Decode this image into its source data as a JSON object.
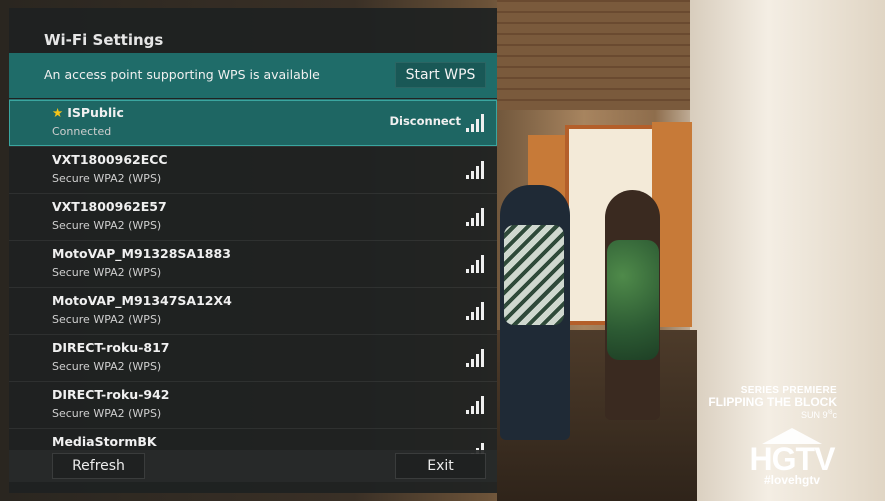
{
  "panel": {
    "title": "Wi-Fi Settings",
    "wps_message": "An access point supporting WPS is available",
    "wps_button": "Start WPS"
  },
  "networks": [
    {
      "name": "ISPublic",
      "status": "Connected",
      "action": "Disconnect",
      "favorite": true,
      "signal_bars": 4
    },
    {
      "name": "VXT1800962ECC",
      "status": "Secure WPA2 (WPS)",
      "signal_bars": 4
    },
    {
      "name": "VXT1800962E57",
      "status": "Secure WPA2 (WPS)",
      "signal_bars": 4
    },
    {
      "name": "MotoVAP_M91328SA1883",
      "status": "Secure WPA2 (WPS)",
      "signal_bars": 4
    },
    {
      "name": "MotoVAP_M91347SA12X4",
      "status": "Secure WPA2 (WPS)",
      "signal_bars": 4
    },
    {
      "name": "DIRECT-roku-817",
      "status": "Secure WPA2 (WPS)",
      "signal_bars": 4
    },
    {
      "name": "DIRECT-roku-942",
      "status": "Secure WPA2 (WPS)",
      "signal_bars": 4
    },
    {
      "name": "MediaStormBK",
      "status": "",
      "signal_bars": 4
    }
  ],
  "footer": {
    "refresh_label": "Refresh",
    "exit_label": "Exit"
  },
  "channel": {
    "promo_line1": "SERIES PREMIERE",
    "promo_line2": "FLIPPING THE BLOCK",
    "promo_line3": "SUN 9",
    "promo_line3_suffix": "c",
    "logo": "HGTV",
    "hashtag": "#lovehgtv"
  },
  "colors": {
    "accent": "#1f6c69",
    "star": "#f5c518"
  }
}
